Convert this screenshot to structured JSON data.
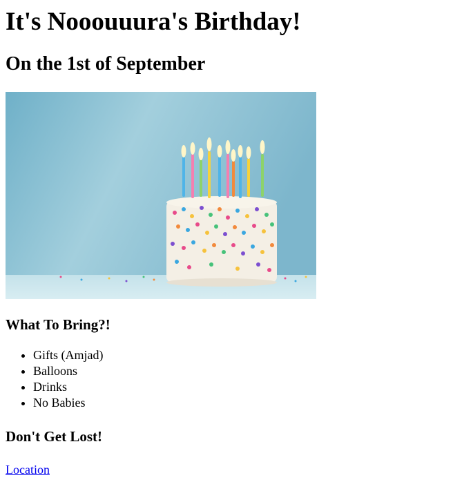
{
  "page": {
    "title": "It's Nooouuura's Birthday!",
    "subtitle": "On the 1st of September"
  },
  "bring": {
    "heading": "What To Bring?!",
    "items": [
      "Gifts (Amjad)",
      "Balloons",
      "Drinks",
      "No Babies"
    ]
  },
  "directions": {
    "heading": "Don't Get Lost!",
    "link_label": "Location"
  },
  "colors": {
    "link": "#0000ee",
    "cake_background": "#8ec2d3",
    "table": "#b9dce6",
    "cake": "#f3eee4"
  }
}
